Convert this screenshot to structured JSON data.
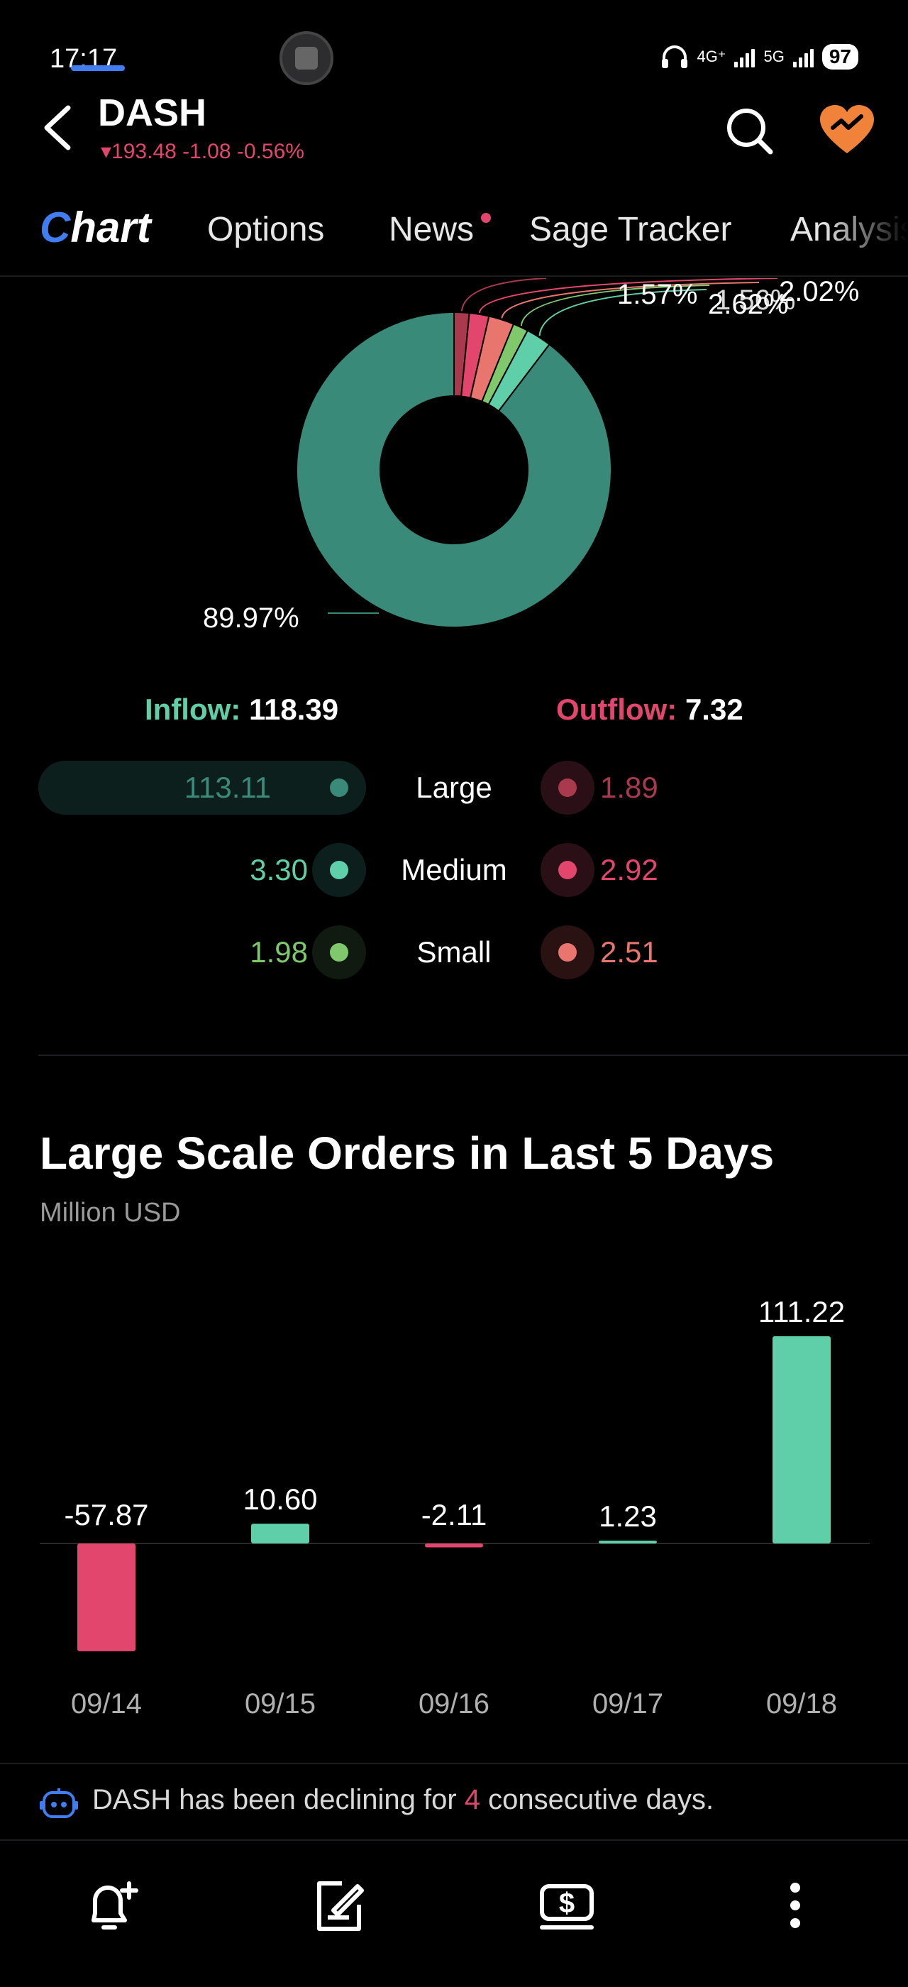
{
  "status_bar": {
    "time": "17:17",
    "net1": "4G⁺",
    "net2": "5G",
    "battery": "97"
  },
  "header": {
    "ticker": "DASH",
    "quote": "193.48 -1.08 -0.56%",
    "down_color": "#e2466c"
  },
  "tabs": [
    "Options",
    "News",
    "Sage Tracker",
    "Analysis"
  ],
  "active_tab": {
    "lead": "C",
    "rest": "hart"
  },
  "donut": {
    "labels": [
      "1.56%",
      "1.57%",
      "2.62%",
      "2.02%",
      "89.97%"
    ],
    "segments": [
      {
        "value": 1.56,
        "color": "#a93a4d"
      },
      {
        "value": 2.02,
        "color": "#e2466c"
      },
      {
        "value": 2.62,
        "color": "#e8756e"
      },
      {
        "value": 1.57,
        "color": "#7fc86b"
      },
      {
        "value": 2.62,
        "color": "#5ecfa8"
      },
      {
        "value": 89.97,
        "color": "#3a8a7a"
      }
    ]
  },
  "flow": {
    "inflow_label": "Inflow:",
    "inflow_value": "118.39",
    "outflow_label": "Outflow:",
    "outflow_value": "7.32",
    "rows": [
      {
        "label": "Large",
        "in": "113.11",
        "out": "1.89",
        "in_color": "#3a8a7a",
        "out_color": "#a93a4d"
      },
      {
        "label": "Medium",
        "in": "3.30",
        "out": "2.92",
        "in_color": "#5ecfa8",
        "out_color": "#e2466c"
      },
      {
        "label": "Small",
        "in": "1.98",
        "out": "2.51",
        "in_color": "#7fc86b",
        "out_color": "#e8756e"
      }
    ]
  },
  "section": {
    "title": "Large Scale Orders in Last 5 Days",
    "subtitle": "Million USD"
  },
  "chart_data": {
    "type": "bar",
    "categories": [
      "09/14",
      "09/15",
      "09/16",
      "09/17",
      "09/18"
    ],
    "values": [
      -57.87,
      10.6,
      -2.11,
      1.23,
      111.22
    ],
    "value_labels": [
      "-57.87",
      "10.60",
      "-2.11",
      "1.23",
      "111.22"
    ],
    "title": "Large Scale Orders in Last 5 Days",
    "ylabel": "Million USD",
    "positive_color": "#5ecfa8",
    "negative_color": "#e2466c"
  },
  "notice": {
    "before": "DASH has been declining for ",
    "count": "4",
    "after": " consecutive days."
  },
  "bottom_bar": [
    "alert-add-icon",
    "note-edit-icon",
    "trade-dollar-icon",
    "more-vertical-icon"
  ]
}
